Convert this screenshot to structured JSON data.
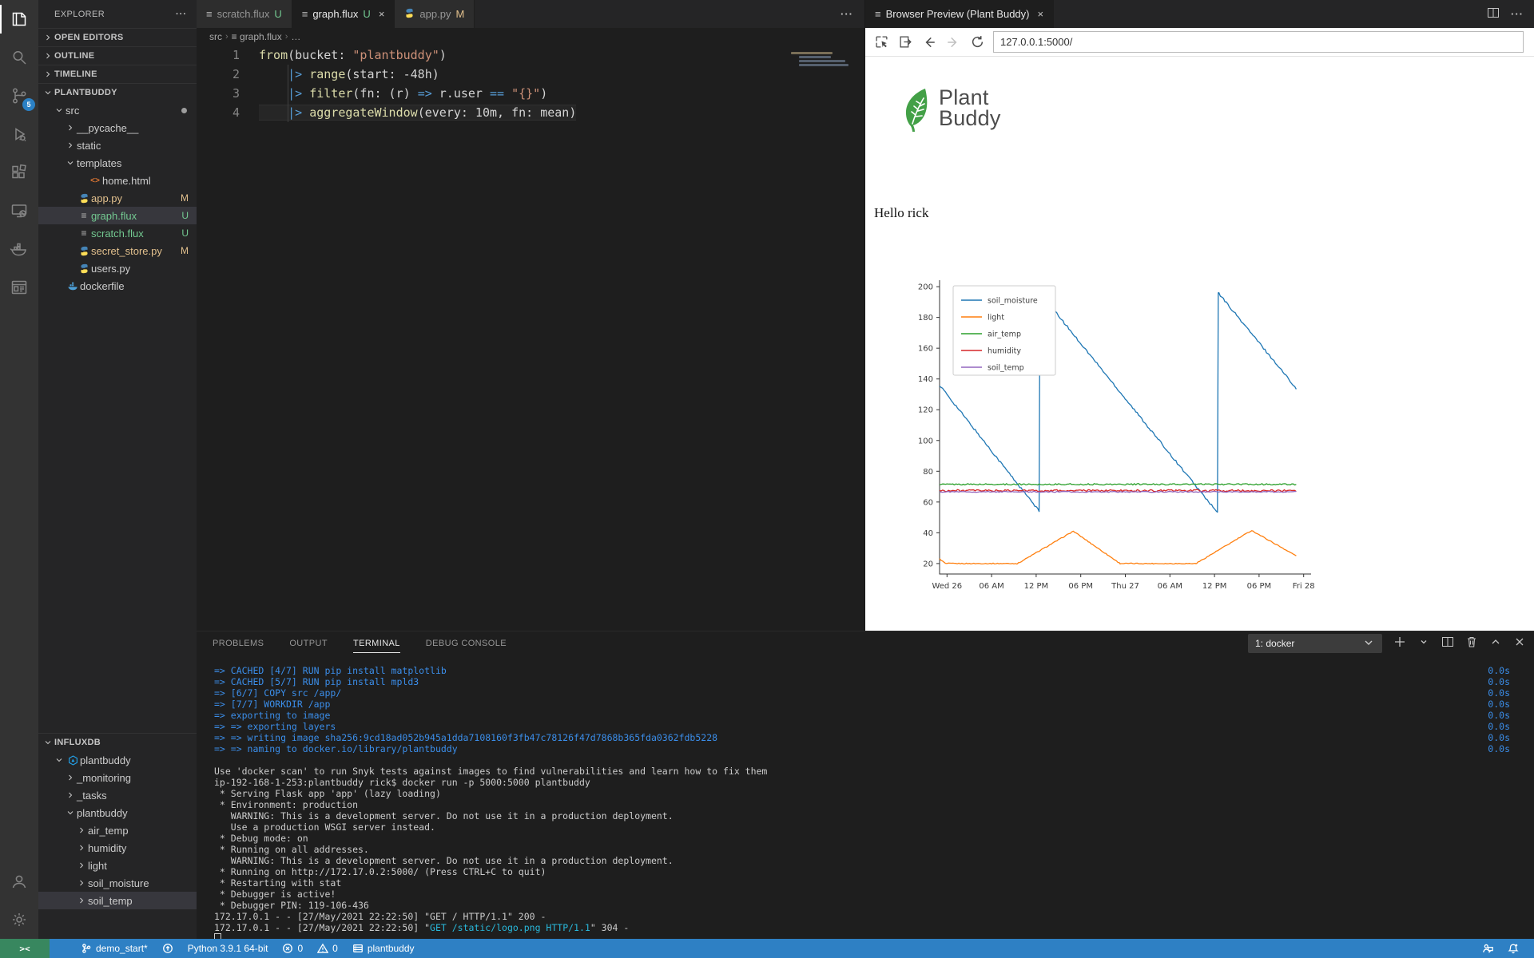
{
  "activity_bar": {
    "scm_badge": "5",
    "items": [
      {
        "name": "explorer",
        "active": true
      },
      {
        "name": "search"
      },
      {
        "name": "source-control",
        "badge": "5"
      },
      {
        "name": "run-debug"
      },
      {
        "name": "extensions"
      },
      {
        "name": "remote-explorer"
      },
      {
        "name": "docker"
      },
      {
        "name": "browser-preview"
      }
    ]
  },
  "sidebar": {
    "title": "EXPLORER",
    "more_actions": "···",
    "sections_top": [
      "OPEN EDITORS",
      "OUTLINE",
      "TIMELINE"
    ],
    "project_label": "PLANTBUDDY",
    "project_tree": [
      {
        "label": "src",
        "indent": 1,
        "chevron": "down",
        "dot": true
      },
      {
        "label": "__pycache__",
        "indent": 2,
        "chevron": "right"
      },
      {
        "label": "static",
        "indent": 2,
        "chevron": "right"
      },
      {
        "label": "templates",
        "indent": 2,
        "chevron": "down"
      },
      {
        "label": "home.html",
        "indent": 3,
        "icon": "html"
      },
      {
        "label": "app.py",
        "indent": 2,
        "icon": "python",
        "badge": "M",
        "color": "mod"
      },
      {
        "label": "graph.flux",
        "indent": 2,
        "icon": "flux",
        "badge": "U",
        "color": "unt",
        "selected": true
      },
      {
        "label": "scratch.flux",
        "indent": 2,
        "icon": "flux",
        "badge": "U",
        "color": "unt"
      },
      {
        "label": "secret_store.py",
        "indent": 2,
        "icon": "python",
        "badge": "M",
        "color": "mod"
      },
      {
        "label": "users.py",
        "indent": 2,
        "icon": "python"
      },
      {
        "label": "dockerfile",
        "indent": 1,
        "icon": "docker"
      }
    ],
    "influx_label": "INFLUXDB",
    "influx_tree": [
      {
        "label": "plantbuddy",
        "indent": 1,
        "chevron": "down",
        "icon": "influx"
      },
      {
        "label": "_monitoring",
        "indent": 2,
        "chevron": "right"
      },
      {
        "label": "_tasks",
        "indent": 2,
        "chevron": "right"
      },
      {
        "label": "plantbuddy",
        "indent": 2,
        "chevron": "down"
      },
      {
        "label": "air_temp",
        "indent": 3,
        "chevron": "right"
      },
      {
        "label": "humidity",
        "indent": 3,
        "chevron": "right"
      },
      {
        "label": "light",
        "indent": 3,
        "chevron": "right"
      },
      {
        "label": "soil_moisture",
        "indent": 3,
        "chevron": "right"
      },
      {
        "label": "soil_temp",
        "indent": 3,
        "chevron": "right",
        "selected": true
      }
    ]
  },
  "editor": {
    "tabs": [
      {
        "label": "scratch.flux",
        "icon": "flux",
        "badge": "U",
        "badge_color": "unt"
      },
      {
        "label": "graph.flux",
        "icon": "flux",
        "badge": "U",
        "badge_color": "unt",
        "active": true,
        "close": "×"
      },
      {
        "label": "app.py",
        "icon": "python",
        "badge": "M",
        "badge_color": "mod"
      }
    ],
    "more_actions": "···",
    "breadcrumb": [
      "src",
      "graph.flux",
      "…"
    ],
    "code": [
      {
        "num": "1",
        "segs": [
          [
            "k",
            "from"
          ],
          [
            "d",
            "(bucket: "
          ],
          [
            "s",
            "\"plantbuddy\""
          ],
          [
            "d",
            ")"
          ]
        ]
      },
      {
        "num": "2",
        "segs": [
          [
            "d",
            "    "
          ],
          [
            "o",
            "|>"
          ],
          [
            "d",
            " "
          ],
          [
            "k",
            "range"
          ],
          [
            "d",
            "(start: -48h)"
          ]
        ]
      },
      {
        "num": "3",
        "segs": [
          [
            "d",
            "    "
          ],
          [
            "o",
            "|>"
          ],
          [
            "d",
            " "
          ],
          [
            "k",
            "filter"
          ],
          [
            "d",
            "(fn: (r) "
          ],
          [
            "o",
            "=>"
          ],
          [
            "d",
            " r.user "
          ],
          [
            "o",
            "=="
          ],
          [
            "d",
            " "
          ],
          [
            "s",
            "\"{}\""
          ],
          [
            "d",
            ")"
          ]
        ]
      },
      {
        "num": "4",
        "segs": [
          [
            "d",
            "    "
          ],
          [
            "o",
            "|>"
          ],
          [
            "d",
            " "
          ],
          [
            "k",
            "aggregateWindow"
          ],
          [
            "d",
            "(every: 10m, fn: mean)"
          ]
        ],
        "current": true
      }
    ]
  },
  "preview": {
    "tab_title": "Browser Preview (Plant Buddy)",
    "tab_close": "×",
    "url": "127.0.0.1:5000/",
    "logo_line1": "Plant",
    "logo_line2": "Buddy",
    "greeting": "Hello rick",
    "logo_green": "#43a047"
  },
  "chart_data": {
    "type": "line",
    "title": "",
    "xlabel": "",
    "ylabel": "",
    "grid": false,
    "legend_position": "upper-left",
    "legend": [
      "soil_moisture",
      "light",
      "air_temp",
      "humidity",
      "soil_temp"
    ],
    "x_axis": {
      "tick_labels": [
        "Wed 26",
        "06 AM",
        "12 PM",
        "06 PM",
        "Thu 27",
        "06 AM",
        "12 PM",
        "06 PM",
        "Fri 28"
      ],
      "tick_hours": [
        1,
        7,
        13,
        19,
        25,
        31,
        37,
        43,
        49
      ],
      "range_hours": [
        0,
        50
      ]
    },
    "y_axis": {
      "ticks": [
        20,
        40,
        60,
        80,
        100,
        120,
        140,
        160,
        180,
        200
      ],
      "range": [
        13.2,
        204.2
      ]
    },
    "series": [
      {
        "name": "soil_moisture",
        "color": "#1f77b4",
        "noise": 0.7,
        "keypoints": [
          [
            0,
            136
          ],
          [
            13.4,
            54
          ],
          [
            13.5,
            196
          ],
          [
            37.4,
            53
          ],
          [
            37.5,
            196
          ],
          [
            48,
            134
          ]
        ]
      },
      {
        "name": "light",
        "color": "#ff7f0e",
        "noise": 0.3,
        "keypoints": [
          [
            0,
            23
          ],
          [
            0.8,
            20
          ],
          [
            10.5,
            20
          ],
          [
            18,
            41
          ],
          [
            24.3,
            20
          ],
          [
            34.5,
            20
          ],
          [
            42,
            41.5
          ],
          [
            48,
            25
          ]
        ]
      },
      {
        "name": "air_temp",
        "color": "#2ca02c",
        "noise": 0.45,
        "keypoints": [
          [
            0,
            71.5
          ],
          [
            48,
            71.5
          ]
        ]
      },
      {
        "name": "humidity",
        "color": "#d62728",
        "noise": 0.65,
        "keypoints": [
          [
            0,
            67.4
          ],
          [
            48,
            67.4
          ]
        ]
      },
      {
        "name": "soil_temp",
        "color": "#9467bd",
        "noise": 0.3,
        "keypoints": [
          [
            0,
            66.6
          ],
          [
            48,
            66.6
          ]
        ]
      }
    ]
  },
  "panel": {
    "tabs": [
      {
        "label": "PROBLEMS"
      },
      {
        "label": "OUTPUT"
      },
      {
        "label": "TERMINAL",
        "active": true
      },
      {
        "label": "DEBUG CONSOLE"
      }
    ],
    "terminal_select": "1: docker",
    "terminal_lines": [
      {
        "segs": [
          [
            "b",
            "=> CACHED [4/7] RUN pip install matplotlib"
          ]
        ],
        "right": "0.0s"
      },
      {
        "segs": [
          [
            "b",
            "=> CACHED [5/7] RUN pip install mpld3"
          ]
        ],
        "right": "0.0s"
      },
      {
        "segs": [
          [
            "b",
            "=> [6/7] COPY src /app/"
          ]
        ],
        "right": "0.0s"
      },
      {
        "segs": [
          [
            "b",
            "=> [7/7] WORKDIR /app"
          ]
        ],
        "right": "0.0s"
      },
      {
        "segs": [
          [
            "b",
            "=> exporting to image"
          ]
        ],
        "right": "0.0s"
      },
      {
        "segs": [
          [
            "b",
            "=> => exporting layers"
          ]
        ],
        "right": "0.0s"
      },
      {
        "segs": [
          [
            "b",
            "=> => writing image sha256:9cd18ad052b945a1dda7108160f3fb47c78126f47d7868b365fda0362fdb5228"
          ]
        ],
        "right": "0.0s"
      },
      {
        "segs": [
          [
            "b",
            "=> => naming to docker.io/library/plantbuddy"
          ]
        ],
        "right": "0.0s"
      },
      {
        "segs": []
      },
      {
        "segs": [
          [
            "w",
            "Use 'docker scan' to run Snyk tests against images to find vulnerabilities and learn how to fix them"
          ]
        ]
      },
      {
        "segs": [
          [
            "w",
            "ip-192-168-1-253:plantbuddy rick$ docker run -p 5000:5000 plantbuddy"
          ]
        ]
      },
      {
        "segs": [
          [
            "w",
            " * Serving Flask app 'app' (lazy loading)"
          ]
        ]
      },
      {
        "segs": [
          [
            "w",
            " * Environment: production"
          ]
        ]
      },
      {
        "segs": [
          [
            "w",
            "   WARNING: This is a development server. Do not use it in a production deployment."
          ]
        ]
      },
      {
        "segs": [
          [
            "w",
            "   Use a production WSGI server instead."
          ]
        ]
      },
      {
        "segs": [
          [
            "w",
            " * Debug mode: on"
          ]
        ]
      },
      {
        "segs": [
          [
            "w",
            " * Running on all addresses."
          ]
        ]
      },
      {
        "segs": [
          [
            "w",
            "   WARNING: This is a development server. Do not use it in a production deployment."
          ]
        ]
      },
      {
        "segs": [
          [
            "w",
            " * Running on http://172.17.0.2:5000/ (Press CTRL+C to quit)"
          ]
        ]
      },
      {
        "segs": [
          [
            "w",
            " * Restarting with stat"
          ]
        ]
      },
      {
        "segs": [
          [
            "w",
            " * Debugger is active!"
          ]
        ]
      },
      {
        "segs": [
          [
            "w",
            " * Debugger PIN: 119-106-436"
          ]
        ]
      },
      {
        "segs": [
          [
            "w",
            "172.17.0.1 - - [27/May/2021 22:22:50] \"GET / HTTP/1.1\" 200 -"
          ]
        ]
      },
      {
        "segs": [
          [
            "w",
            "172.17.0.1 - - [27/May/2021 22:22:50] \""
          ],
          [
            "c",
            "GET /static/logo.png HTTP/1.1"
          ],
          [
            "w",
            "\" 304 -"
          ]
        ]
      },
      {
        "cursor": true,
        "segs": []
      }
    ]
  },
  "status_bar": {
    "remote_icon_text": "><",
    "left": [
      {
        "icon": "branch",
        "text": "demo_start*"
      },
      {
        "icon": "sync",
        "text": ""
      },
      {
        "icon": "",
        "text": "Python 3.9.1 64-bit"
      },
      {
        "icon": "error",
        "text": "0"
      },
      {
        "icon": "warning",
        "text": "0"
      },
      {
        "icon": "db",
        "text": "plantbuddy"
      }
    ],
    "right_icons": [
      "feedback",
      "bell"
    ]
  }
}
